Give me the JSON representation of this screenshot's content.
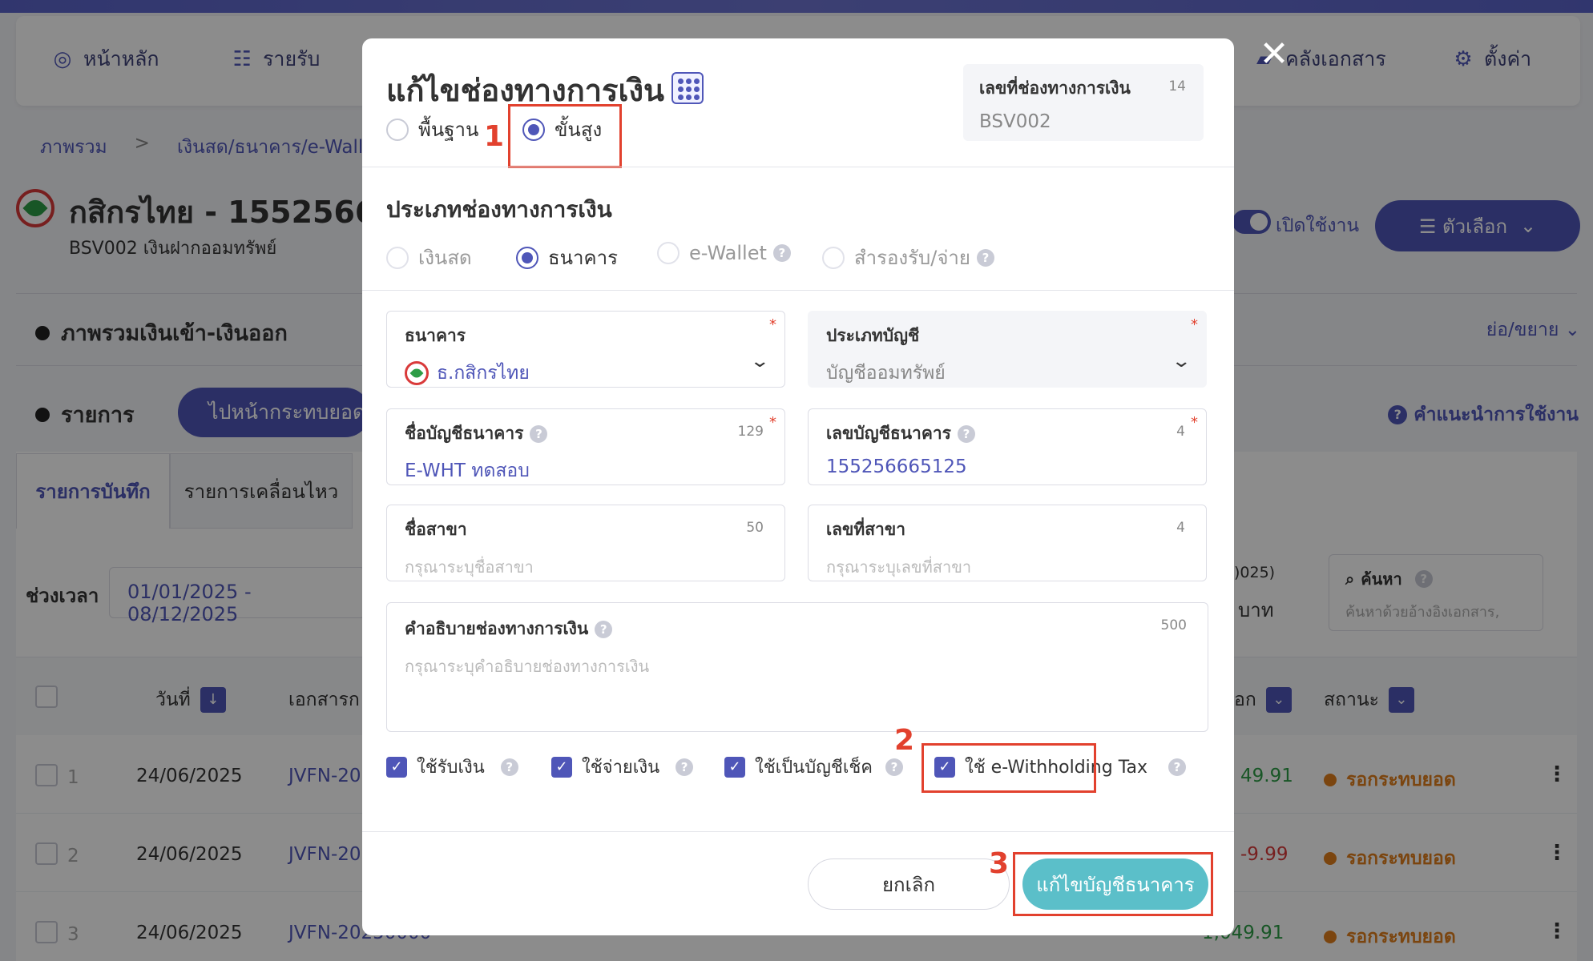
{
  "nav": {
    "items": [
      {
        "label": "หน้าหลัก",
        "icon": "dashboard-icon"
      },
      {
        "label": "รายรับ",
        "icon": "income-list-icon"
      },
      {
        "label": "คลังเอกสาร",
        "icon": "folder-icon"
      },
      {
        "label": "ตั้งค่า",
        "icon": "gear-icon"
      }
    ]
  },
  "breadcrumb": {
    "items": [
      "ภาพรวม",
      ">",
      "เงินสด/ธนาคาร/e-Walle"
    ]
  },
  "account": {
    "title": "กสิกรไทย - 15525666",
    "subtitle": "BSV002 เงินฝากออมทรัพย์",
    "toggle_label": "เปิดใช้งาน",
    "options_label": "☰ ตัวเลือก"
  },
  "sections": {
    "overview": "ภาพรวมเงินเข้า-เงินออก",
    "collapse": "ย่อ/ขยาย",
    "list": "รายการ",
    "goto_reconcile": "ไปหน้ากระทบยอด",
    "help": "คำแนะนำการใช้งาน"
  },
  "tabs": [
    "รายการบันทึก",
    "รายการเคลื่อนไหว"
  ],
  "filters": {
    "period_label": "ช่วงเวลา",
    "period_value": "01/01/2025 - 08/12/2025",
    "frag1": ")025)",
    "frag2": "บาท",
    "search_label": "ค้นหา",
    "search_placeholder": "ค้นหาด้วยอ้างอิงเอกสาร,"
  },
  "table": {
    "headers": {
      "date": "วันที่",
      "doc": "เอกสารก",
      "out": "อก",
      "status": "สถานะ"
    },
    "rows": [
      {
        "num": "1",
        "date": "24/06/2025",
        "doc": "JVFN-20",
        "amount": "49.91",
        "amount_type": "green",
        "status": "รอกระทบยอด"
      },
      {
        "num": "2",
        "date": "24/06/2025",
        "doc": "JVFN-20",
        "amount": "-9.99",
        "amount_type": "red",
        "status": "รอกระทบยอด"
      },
      {
        "num": "3",
        "date": "24/06/2025",
        "doc": "JVFN-20250000",
        "amount": "1,049.91",
        "amount_type": "green",
        "status": "รอกระทบยอด"
      }
    ]
  },
  "modal": {
    "title": "แก้ไขช่องทางการเงิน",
    "mode_basic": "พื้นฐาน",
    "mode_advanced": "ขั้นสูง",
    "doc_no_label": "เลขที่ช่องทางการเงิน",
    "doc_no_count": "14",
    "doc_no_value": "BSV002",
    "type_section": "ประเภทช่องทางการเงิน",
    "types": [
      "เงินสด",
      "ธนาคาร",
      "e-Wallet",
      "สำรองรับ/จ่าย"
    ],
    "selected_type": "ธนาคาร",
    "bank": {
      "label": "ธนาคาร",
      "value": "ธ.กสิกรไทย"
    },
    "account_type": {
      "label": "ประเภทบัญชี",
      "value": "บัญชีออมทรัพย์"
    },
    "account_name": {
      "label": "ชื่อบัญชีธนาคาร",
      "count": "129",
      "value": "E-WHT ทดสอบ"
    },
    "account_number": {
      "label": "เลขบัญชีธนาคาร",
      "count": "4",
      "value": "155256665125"
    },
    "branch_name": {
      "label": "ชื่อสาขา",
      "count": "50",
      "placeholder": "กรุณาระบุชื่อสาขา"
    },
    "branch_no": {
      "label": "เลขที่สาขา",
      "count": "4",
      "placeholder": "กรุณาระบุเลขที่สาขา"
    },
    "description": {
      "label": "คำอธิบายช่องทางการเงิน",
      "count": "500",
      "placeholder": "กรุณาระบุคำอธิบายช่องทางการเงิน"
    },
    "checks": [
      {
        "label": "ใช้รับเงิน",
        "checked": true
      },
      {
        "label": "ใช้จ่ายเงิน",
        "checked": true
      },
      {
        "label": "ใช้เป็นบัญชีเช็ค",
        "checked": true
      },
      {
        "label": "ใช้ e-Withholding Tax",
        "checked": true
      }
    ],
    "cancel_label": "ยกเลิก",
    "save_label": "แก้ไขบัญชีธนาคาร",
    "required_mark": "*",
    "help_mark": "?",
    "check_mark": "✓"
  },
  "annotations": [
    "1",
    "2",
    "3"
  ],
  "colors": {
    "brand": "#4f56b8",
    "accent_teal": "#5bbfc9",
    "highlight": "#e2412e",
    "pending": "#e07f1c"
  }
}
